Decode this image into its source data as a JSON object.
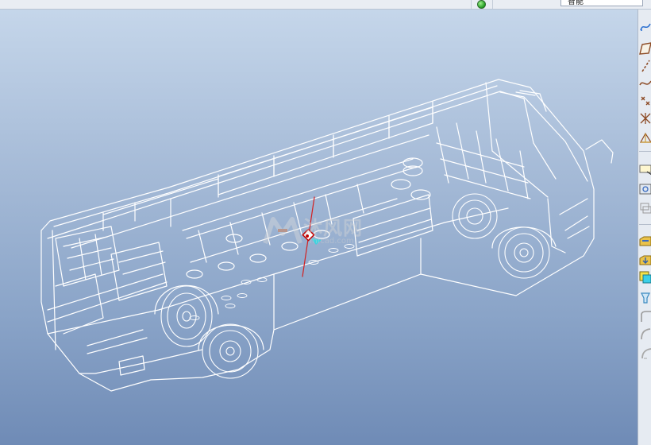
{
  "topbar": {
    "filter_value": "智能"
  },
  "watermark": {
    "text": "沐风网",
    "url": "mfcad.com"
  },
  "colors": {
    "viewport_top": "#c5d6ea",
    "viewport_bottom": "#6f8bb6",
    "wireframe": "#ffffff",
    "datum_axis": "#d42020"
  },
  "toolbar": {
    "icons": [
      "sketch-curve-icon",
      "datum-plane-icon",
      "datum-axis-icon",
      "datum-curve-icon",
      "datum-point-icon",
      "point-offset-icon",
      "coordinate-system-icon",
      "analysis-icon",
      "view-manager-icon",
      "layer-icon",
      "insert-feature-icon",
      "extrude-icon",
      "revolve-icon",
      "sweep-icon",
      "blend-icon",
      "round-icon",
      "chamfer-icon"
    ]
  }
}
